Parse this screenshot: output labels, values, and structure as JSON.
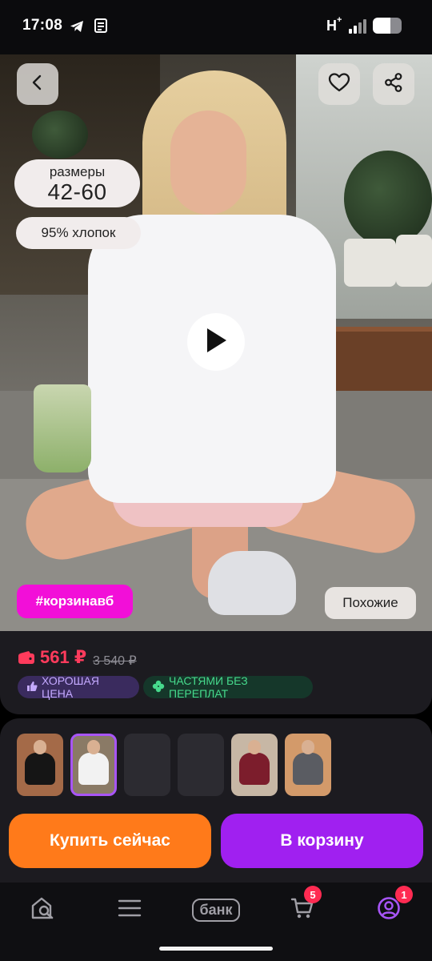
{
  "status_bar": {
    "time": "17:08",
    "network": "H",
    "network_sup": "+",
    "battery_level": 0.6,
    "icons": [
      "telegram-icon",
      "notes-icon",
      "signal-icon",
      "battery-icon"
    ]
  },
  "hero": {
    "sizes_label": "размеры",
    "sizes_value": "42-60",
    "material": "95% хлопок",
    "hashtag": "#корзинавб",
    "similar_label": "Похожие",
    "icons": [
      "back-icon",
      "heart-icon",
      "share-icon",
      "play-icon"
    ]
  },
  "price": {
    "current": "561 ₽",
    "old": "3 540 ₽",
    "badge_good": "ХОРОШАЯ ЦЕНА",
    "badge_installments": "ЧАСТЯМИ БЕЗ ПЕРЕПЛАТ",
    "colors": {
      "current": "#ff3b5c",
      "good": "#c4a9ff",
      "installments": "#46d98c"
    }
  },
  "gallery": {
    "selected_index": 1,
    "thumb_count": 6
  },
  "actions": {
    "buy_now": "Купить сейчас",
    "add_to_cart": "В корзину",
    "colors": {
      "buy_now": "#ff7a1a",
      "add_to_cart": "#a020f0"
    }
  },
  "bottom_nav": {
    "bank_label": "банк",
    "cart_badge": "5",
    "profile_badge": "1",
    "icons": [
      "home-search-icon",
      "catalog-icon",
      "bank-icon",
      "cart-icon",
      "profile-icon"
    ],
    "accent": "#a855f7"
  }
}
